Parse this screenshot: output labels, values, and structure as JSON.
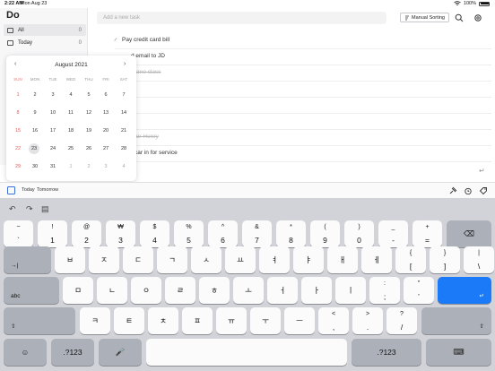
{
  "status": {
    "time": "2:22 AM",
    "date": "Mon Aug 23",
    "battery": "100%"
  },
  "app": {
    "title": "Do"
  },
  "sidebar": {
    "items": [
      {
        "label": "All",
        "count": "0"
      },
      {
        "label": "Today",
        "count": "0"
      }
    ]
  },
  "topbar": {
    "new_task_placeholder": "Add a new task",
    "sort_label": "Manual Sorting"
  },
  "tasks": [
    {
      "text": "Pay credit card bill",
      "done": false
    },
    {
      "text": "d email to JD",
      "done": false
    },
    {
      "text": "ano class",
      "done": true
    },
    {
      "text": "t",
      "done": false
    },
    {
      "text": "for Henry",
      "done": true
    },
    {
      "text": "car in for service",
      "done": false
    }
  ],
  "calendar": {
    "month_title": "August 2021",
    "weekdays": [
      "SUN",
      "MON",
      "TUE",
      "WED",
      "THU",
      "FRI",
      "SAT"
    ],
    "weeks": [
      [
        "1",
        "2",
        "3",
        "4",
        "5",
        "6",
        "7"
      ],
      [
        "8",
        "9",
        "10",
        "11",
        "12",
        "13",
        "14"
      ],
      [
        "15",
        "16",
        "17",
        "18",
        "19",
        "20",
        "21"
      ],
      [
        "22",
        "23",
        "24",
        "25",
        "26",
        "27",
        "28"
      ],
      [
        "29",
        "30",
        "31",
        "1",
        "2",
        "3",
        "4"
      ]
    ],
    "today": "23"
  },
  "quickbar": {
    "today_label": "Today",
    "tomorrow_label": "Tomorrow"
  },
  "keyboard": {
    "row1": [
      {
        "up": "~",
        "dn": "`"
      },
      {
        "up": "!",
        "dn": "1"
      },
      {
        "up": "@",
        "dn": "2"
      },
      {
        "up": "₩",
        "dn": "3"
      },
      {
        "up": "%",
        "dn": "5"
      },
      {
        "up": "^",
        "dn": "6"
      },
      {
        "up": "&",
        "dn": "7"
      },
      {
        "up": "*",
        "dn": "8"
      },
      {
        "up": "(",
        "dn": "9"
      },
      {
        "up": ")",
        "dn": "0"
      },
      {
        "up": "_",
        "dn": "-"
      },
      {
        "up": "+",
        "dn": "="
      }
    ],
    "row1_extra": {
      "up": "$",
      "dn": "4"
    },
    "row2": [
      "ㅂ",
      "ㅈ",
      "ㄷ",
      "ㄱ",
      "ㅅ",
      "ㅛ",
      "ㅕ",
      "ㅑ",
      "ㅐ",
      "ㅔ"
    ],
    "row2_brackets": [
      {
        "up": "{",
        "dn": "["
      },
      {
        "up": "}",
        "dn": "]"
      },
      {
        "up": "|",
        "dn": "\\"
      }
    ],
    "row3": [
      "ㅁ",
      "ㄴ",
      "ㅇ",
      "ㄹ",
      "ㅎ",
      "ㅗ",
      "ㅓ",
      "ㅏ",
      "ㅣ"
    ],
    "row3_punct": [
      {
        "up": ":",
        "dn": ";"
      },
      {
        "up": "”",
        "dn": "’"
      }
    ],
    "row4": [
      "ㅋ",
      "ㅌ",
      "ㅊ",
      "ㅍ",
      "ㅠ",
      "ㅜ",
      "ㅡ"
    ],
    "row4_punct": [
      {
        "up": "<",
        "dn": ","
      },
      {
        "up": ">",
        "dn": "."
      },
      {
        "up": "?",
        "dn": "/"
      }
    ],
    "abc_label": "abc",
    "num_label": ".?123",
    "tab_label": "→|"
  },
  "colors": {
    "accent": "#1a7af8",
    "sunday": "#e05d5d"
  }
}
